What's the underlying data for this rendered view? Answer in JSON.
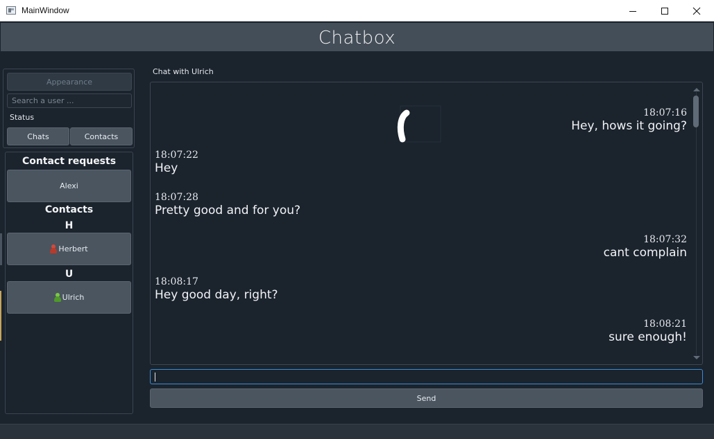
{
  "window": {
    "title": "MainWindow",
    "controls": {
      "minimize": "minimize-icon",
      "maximize": "maximize-icon",
      "close": "close-icon"
    }
  },
  "app": {
    "title": "Chatbox"
  },
  "sidebar": {
    "appearance_label": "Appearance",
    "search_placeholder": "Search a user ...",
    "status_label": "Status",
    "tabs": [
      {
        "label": "Chats"
      },
      {
        "label": "Contacts"
      }
    ],
    "contact_requests_heading": "Contact requests",
    "contact_requests": [
      {
        "name": "Alexi"
      }
    ],
    "contacts_heading": "Contacts",
    "groups": [
      {
        "letter": "H",
        "contacts": [
          {
            "name": "Herbert",
            "status_color": "#c0392b",
            "icon": "person-offline-icon"
          }
        ]
      },
      {
        "letter": "U",
        "contacts": [
          {
            "name": "Ulrich",
            "status_color": "#5fb336",
            "icon": "person-online-icon"
          }
        ]
      }
    ]
  },
  "chat": {
    "header": "Chat with Ulrich",
    "messages": [
      {
        "side": "right",
        "time": "18:07:16",
        "text": "Hey, hows it going?"
      },
      {
        "side": "left",
        "time": "18:07:22",
        "text": "Hey"
      },
      {
        "side": "left",
        "time": "18:07:28",
        "text": "Pretty good and for you?"
      },
      {
        "side": "right",
        "time": "18:07:32",
        "text": "cant complain"
      },
      {
        "side": "left",
        "time": "18:08:17",
        "text": "Hey good day, right?"
      },
      {
        "side": "right",
        "time": "18:08:21",
        "text": "sure enough!"
      }
    ],
    "input_value": "",
    "send_label": "Send"
  },
  "colors": {
    "background": "#1b232d",
    "banner": "#444e58",
    "button": "#4a5560",
    "focus_border": "#3a8ed6"
  }
}
